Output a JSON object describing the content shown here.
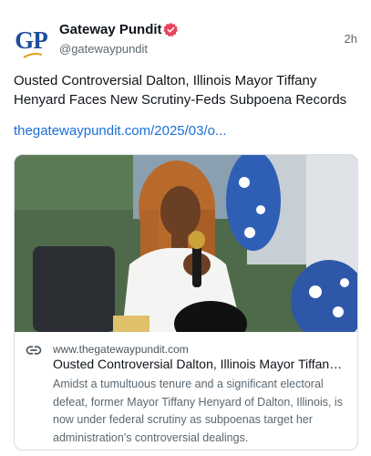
{
  "author": {
    "avatar_text": "GP",
    "name": "Gateway Pundit",
    "handle": "@gatewaypundit",
    "verified_icon": "verified-badge-icon",
    "brand_color": "#1f4e9c",
    "badge_color": "#e8455e"
  },
  "post": {
    "timestamp": "2h",
    "text": "Ousted Controversial Dalton, Illinois Mayor Tiffany Henyard Faces New Scrutiny-Feds Subpoena Records",
    "link": "thegatewaypundit.com/2025/03/o...",
    "link_color": "#1a6fd8"
  },
  "card": {
    "link_icon": "link-icon",
    "domain": "www.thegatewaypundit.com",
    "title": "Ousted Controversial Dalton, Illinois Mayor Tiffany Henyard Faces New Scrutiny",
    "description": "Amidst a tumultuous tenure and a significant electoral defeat, former Mayor Tiffany Henyard of Dalton, Illinois, is now under federal scrutiny as subpoenas target her administration's controversial dealings."
  }
}
